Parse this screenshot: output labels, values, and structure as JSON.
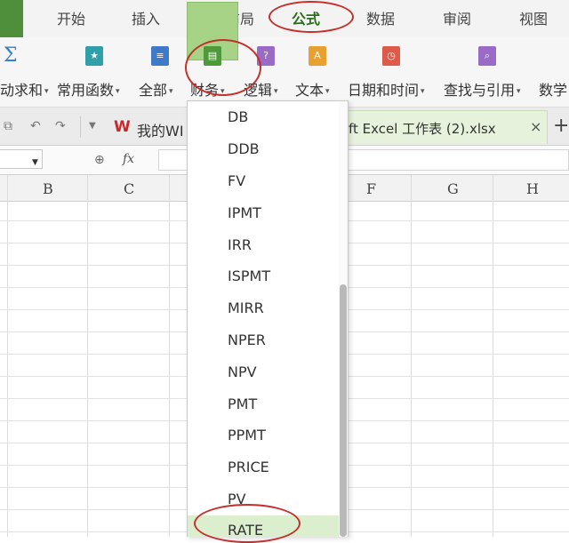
{
  "tabs": [
    {
      "label": "开始"
    },
    {
      "label": "插入"
    },
    {
      "label": "页面布局"
    },
    {
      "label": "公式"
    },
    {
      "label": "数据"
    },
    {
      "label": "审阅"
    },
    {
      "label": "视图"
    }
  ],
  "active_tab": "公式",
  "ribbon": {
    "autosum_icon": "Σ",
    "items": [
      {
        "label": "动求和"
      },
      {
        "label": "常用函数"
      },
      {
        "label": "全部"
      },
      {
        "label": "财务"
      },
      {
        "label": "逻辑"
      },
      {
        "label": "文本"
      },
      {
        "label": "日期和时间"
      },
      {
        "label": "查找与引用"
      },
      {
        "label": "数学"
      }
    ],
    "caret": "▾"
  },
  "quick_bar": {
    "wps_logo": "W",
    "wps_doc_label": "我的WI",
    "active_doc_label": "ft Excel 工作表 (2).xlsx",
    "close": "×",
    "new_tab": "+"
  },
  "formula_bar": {
    "fx_label": "fx"
  },
  "columns": [
    "B",
    "C",
    "F",
    "G",
    "H"
  ],
  "finance_menu": {
    "items": [
      "DB",
      "DDB",
      "FV",
      "IPMT",
      "IRR",
      "ISPMT",
      "MIRR",
      "NPER",
      "NPV",
      "PMT",
      "PPMT",
      "PRICE",
      "PV",
      "RATE"
    ],
    "highlighted": "RATE"
  },
  "colors": {
    "accent_green": "#4f8f3c",
    "ribbon_highlight": "#a7d387",
    "annotation_red": "#c4302b",
    "menu_highlight": "#dbeecd"
  }
}
